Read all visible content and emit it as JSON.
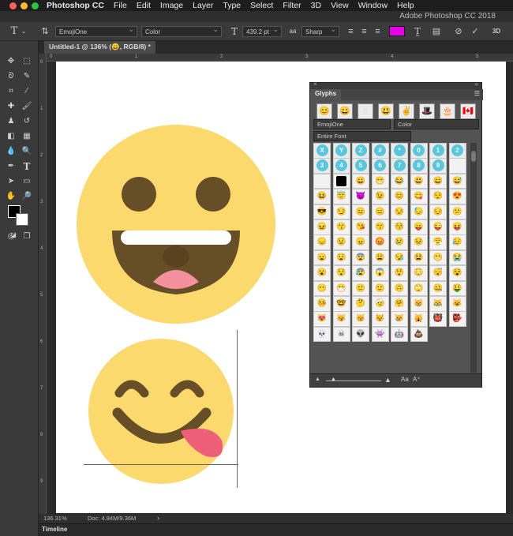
{
  "menubar": {
    "items": [
      "Photoshop CC",
      "File",
      "Edit",
      "Image",
      "Layer",
      "Type",
      "Select",
      "Filter",
      "3D",
      "View",
      "Window",
      "Help"
    ],
    "traffic_colors": [
      "#fe5f57",
      "#febc2e",
      "#28c840"
    ]
  },
  "titlebar": {
    "title": "Adobe Photoshop CC 2018"
  },
  "options": {
    "font_family": "EmojiOne",
    "font_style": "Color",
    "font_size": "439.2 pt",
    "aa_label": "a",
    "antialias": "Sharp",
    "text_color": "#e800e8"
  },
  "document": {
    "tab": "Untitled-1 @ 136% (😀, RGB/8) *"
  },
  "rulers": {
    "top": [
      "0",
      "1",
      "2",
      "3",
      "4",
      "5"
    ],
    "left": [
      "0",
      "1",
      "2",
      "3",
      "4",
      "5",
      "6",
      "7",
      "8",
      "9"
    ]
  },
  "status": {
    "zoom": "136.31%",
    "doc": "Doc: 4.84M/9.36M",
    "arrow": "›"
  },
  "timeline": {
    "label": "Timeline"
  },
  "glyphs": {
    "title": "Glyphs",
    "recent": [
      "😊",
      "😀",
      "8",
      "😃",
      "✌",
      "🎩",
      "🎂",
      "🇨🇦"
    ],
    "font_family": "EmojiOne",
    "font_style": "Color",
    "filter": "Entire Font",
    "keycaps": [
      "X",
      "Y",
      "Z",
      "#",
      "*",
      "0",
      "1",
      "2",
      "3",
      "4",
      "5",
      "6",
      "7",
      "8",
      "9"
    ],
    "emojis": [
      "😀",
      "😁",
      "😂",
      "😃",
      "😄",
      "😅",
      "😆",
      "😇",
      "😈",
      "😉",
      "😊",
      "😋",
      "😌",
      "😍",
      "😎",
      "😏",
      "😐",
      "😑",
      "😒",
      "😓",
      "😔",
      "😕",
      "😖",
      "😗",
      "😘",
      "😙",
      "😚",
      "😛",
      "😜",
      "😝",
      "😞",
      "😟",
      "😠",
      "😡",
      "😢",
      "😣",
      "😤",
      "😥",
      "😦",
      "😧",
      "😨",
      "😩",
      "😪",
      "😫",
      "😬",
      "😭",
      "😮",
      "😯",
      "😰",
      "😱",
      "😲",
      "😳",
      "😴",
      "😵",
      "😶",
      "😷",
      "🙁",
      "🙂",
      "🙃",
      "🙄",
      "🤐",
      "🤑",
      "🤒",
      "🤓",
      "🤔",
      "🤕",
      "🤗",
      "😸",
      "😹",
      "😺",
      "😻",
      "😼",
      "😽",
      "😾",
      "😿",
      "🙀",
      "👹",
      "👺",
      "💀",
      "☠",
      "👽",
      "👾",
      "🤖",
      "💩"
    ]
  }
}
